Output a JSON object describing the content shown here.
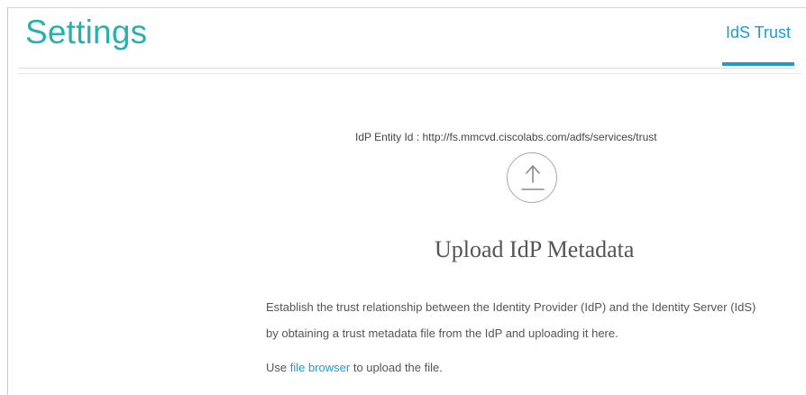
{
  "header": {
    "title": "Settings",
    "active_tab": "IdS Trust",
    "accent_color": "#2bb0b0",
    "tab_color": "#1b9dcf"
  },
  "main": {
    "entity_id_label": "IdP Entity Id :",
    "entity_id_value": "http://fs.mmcvd.ciscolabs.com/adfs/services/trust",
    "upload_icon": "upload-arrow-icon",
    "upload_heading": "Upload IdP Metadata",
    "description_line_1": "Establish the trust relationship between the Identity Provider (IdP) and the Identity Server (IdS)",
    "description_line_2": "by obtaining a trust metadata file from the IdP and uploading it here.",
    "use_prefix": "Use",
    "file_browser_link": "file browser",
    "use_suffix": "to upload the file."
  }
}
